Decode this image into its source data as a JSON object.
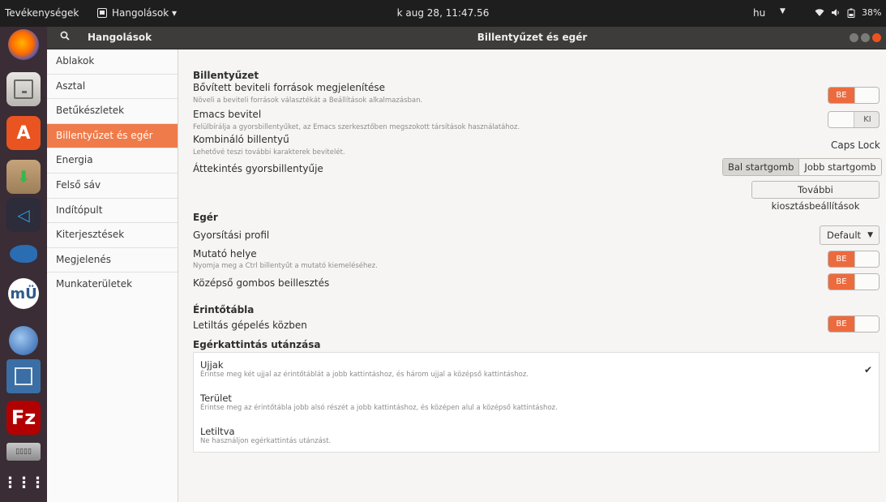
{
  "topbar": {
    "activities": "Tevékenységek",
    "app_menu": "Hangolások ▾",
    "clock": "k aug 28, 11:47.56",
    "language": "hu",
    "language_arrow": "▼",
    "battery": "38%",
    "menu_arrow": "▾"
  },
  "dock": {
    "items": [
      {
        "icon": "firefox-icon",
        "color": "#e66000"
      },
      {
        "icon": "file-cabinet-icon",
        "color": "#6b6b6b"
      },
      {
        "icon": "software-center-icon",
        "color": "#e95420"
      },
      {
        "icon": "package-icon",
        "color": "#9b7e59"
      },
      {
        "icon": "vscode-icon",
        "color": "#2c7ad6"
      },
      {
        "icon": "fish-icon",
        "color": "#2b6db3"
      },
      {
        "icon": "mu-editor-icon",
        "color": "#2f5b8a"
      },
      {
        "icon": "thunderbird-icon",
        "color": "#2a5da8"
      },
      {
        "icon": "disk-utility-icon",
        "color": "#3a6ea5"
      },
      {
        "icon": "filezilla-icon",
        "color": "#b30000"
      },
      {
        "icon": "keyboard-icon",
        "color": "#777"
      },
      {
        "icon": "app-grid-icon",
        "color": "transparent"
      }
    ]
  },
  "header": {
    "app_title": "Hangolások",
    "panel_title": "Billentyűzet és egér"
  },
  "sidebar": {
    "items": [
      {
        "label": "Ablakok"
      },
      {
        "label": "Asztal"
      },
      {
        "label": "Betűkészletek"
      },
      {
        "label": "Billentyűzet és egér",
        "active": true
      },
      {
        "label": "Energia"
      },
      {
        "label": "Felső sáv"
      },
      {
        "label": "Indítópult"
      },
      {
        "label": "Kiterjesztések"
      },
      {
        "label": "Megjelenés"
      },
      {
        "label": "Munkaterületek"
      }
    ]
  },
  "keyboard": {
    "title": "Billentyűzet",
    "extended_sources": {
      "label": "Bővített beviteli források megjelenítése",
      "desc": "Növeli a beviteli források választékát a Beállítások alkalmazásban.",
      "state": "BE"
    },
    "emacs": {
      "label": "Emacs bevitel",
      "desc": "Felülbírálja a gyorsbillentyűket, az Emacs szerkesztőben megszokott társítások használatához.",
      "state": "KI"
    },
    "compose": {
      "label": "Kombináló billentyű",
      "desc": "Lehetővé teszi további karakterek bevitelét.",
      "value": "Caps Lock"
    },
    "overview_shortcut": {
      "label": "Áttekintés gyorsbillentyűje",
      "options": [
        "Bal startgomb",
        "Jobb startgomb"
      ],
      "selected": "Bal startgomb"
    },
    "layout_button": "További kiosztásbeállítások"
  },
  "mouse": {
    "title": "Egér",
    "accel_profile": {
      "label": "Gyorsítási profil",
      "value": "Default"
    },
    "pointer_location": {
      "label": "Mutató helye",
      "desc": "Nyomja meg a Ctrl billentyűt a mutató kiemeléséhez.",
      "state": "BE"
    },
    "middle_click": {
      "label": "Középső gombos beillesztés",
      "state": "BE"
    }
  },
  "touchpad": {
    "title": "Érintőtábla",
    "disable_while_typing": {
      "label": "Letiltás gépelés közben",
      "state": "BE"
    }
  },
  "click_emulation": {
    "title": "Egérkattintás utánzása",
    "options": [
      {
        "label": "Ujjak",
        "desc": "Érintse meg két ujjal az érintőtáblát a jobb kattintáshoz, és három ujjal a középső kattintáshoz.",
        "selected": true
      },
      {
        "label": "Terület",
        "desc": "Érintse meg az érintőtábla jobb alsó részét a jobb kattintáshoz, és középen alul a középső kattintáshoz."
      },
      {
        "label": "Letiltva",
        "desc": "Ne használjon egérkattintás utánzást."
      }
    ],
    "checkmark": "✔"
  },
  "colors": {
    "accent": "#ec6b3e",
    "topbar": "#1e1e1e",
    "dock": "#3a2d35"
  }
}
